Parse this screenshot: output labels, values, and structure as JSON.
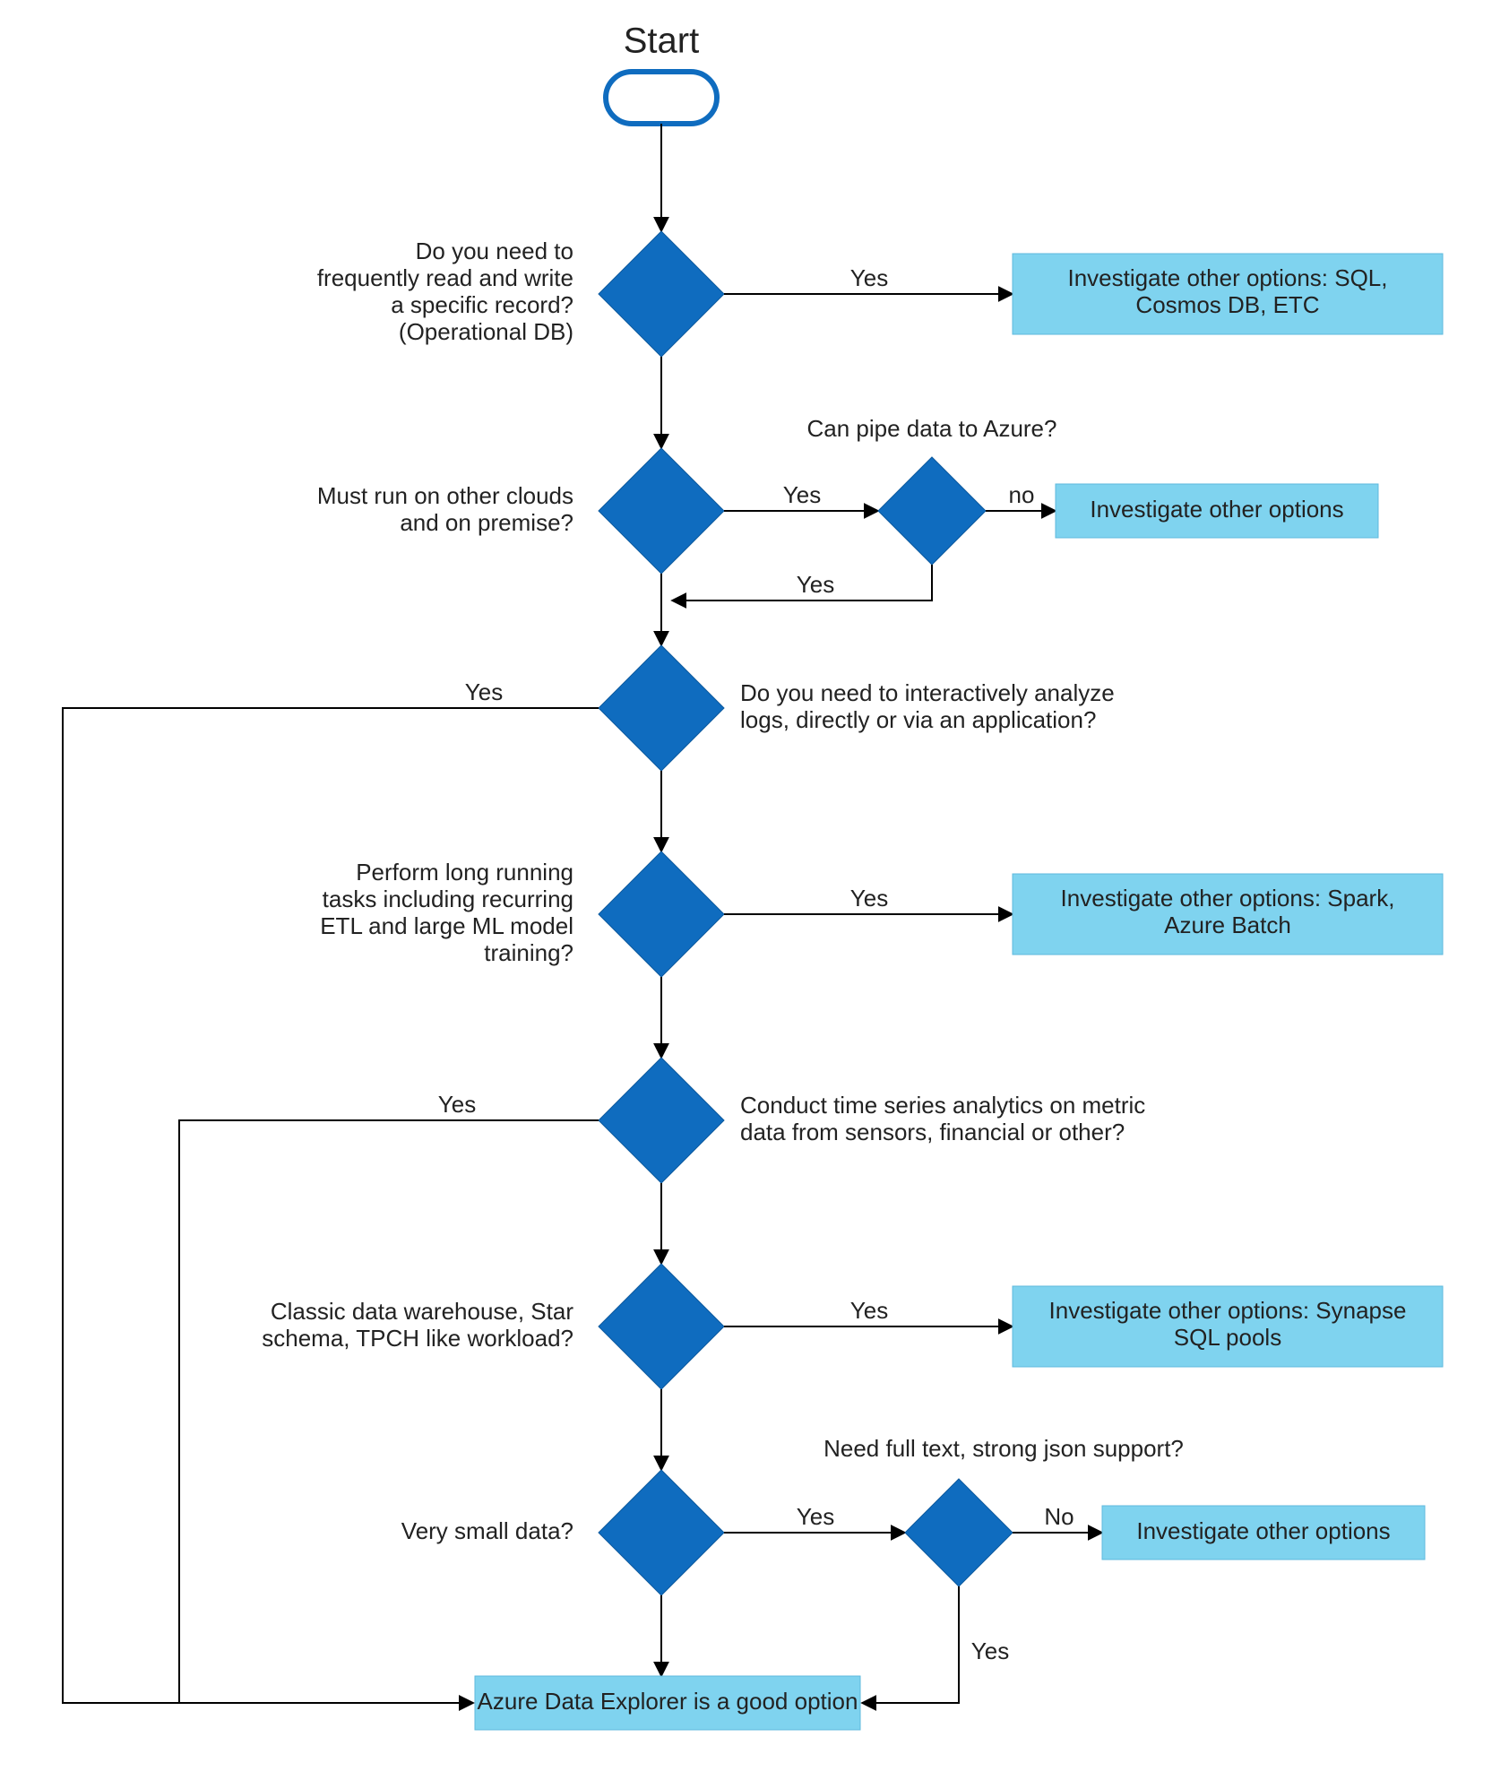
{
  "title": "Start",
  "nodes": {
    "q1": {
      "lines": [
        "Do you need to",
        "frequently read and write",
        "a specific record?",
        "(Operational DB)"
      ],
      "side": "left"
    },
    "q2": {
      "lines": [
        "Must run on other clouds",
        "and on premise?"
      ],
      "side": "left"
    },
    "q2b": {
      "lines": [
        "Can pipe data to Azure?"
      ],
      "side": "top"
    },
    "q3": {
      "lines": [
        "Do you need to interactively analyze",
        "logs, directly or via an application?"
      ],
      "side": "right"
    },
    "q4": {
      "lines": [
        "Perform long running",
        "tasks including recurring",
        "ETL and large ML model",
        "training?"
      ],
      "side": "left"
    },
    "q5": {
      "lines": [
        "Conduct time series analytics on metric",
        "data from sensors, financial or other?"
      ],
      "side": "right"
    },
    "q6": {
      "lines": [
        "Classic data warehouse, Star",
        "schema, TPCH like workload?"
      ],
      "side": "left"
    },
    "q7": {
      "lines": [
        "Very small data?"
      ],
      "side": "left"
    },
    "q7b": {
      "lines": [
        "Need full text, strong json support?"
      ],
      "side": "top"
    }
  },
  "outcomes": {
    "o1": {
      "lines": [
        "Investigate other options: SQL,",
        "Cosmos DB, ETC"
      ]
    },
    "o2": {
      "lines": [
        "Investigate other options"
      ]
    },
    "o4": {
      "lines": [
        "Investigate other options: Spark,",
        "Azure Batch"
      ]
    },
    "o6": {
      "lines": [
        "Investigate other options: Synapse",
        "SQL pools"
      ]
    },
    "o7": {
      "lines": [
        "Investigate other options"
      ]
    },
    "final": {
      "lines": [
        "Azure Data Explorer is a good option"
      ]
    }
  },
  "edge_labels": {
    "yes": "Yes",
    "no": "No",
    "no_lc": "no"
  }
}
